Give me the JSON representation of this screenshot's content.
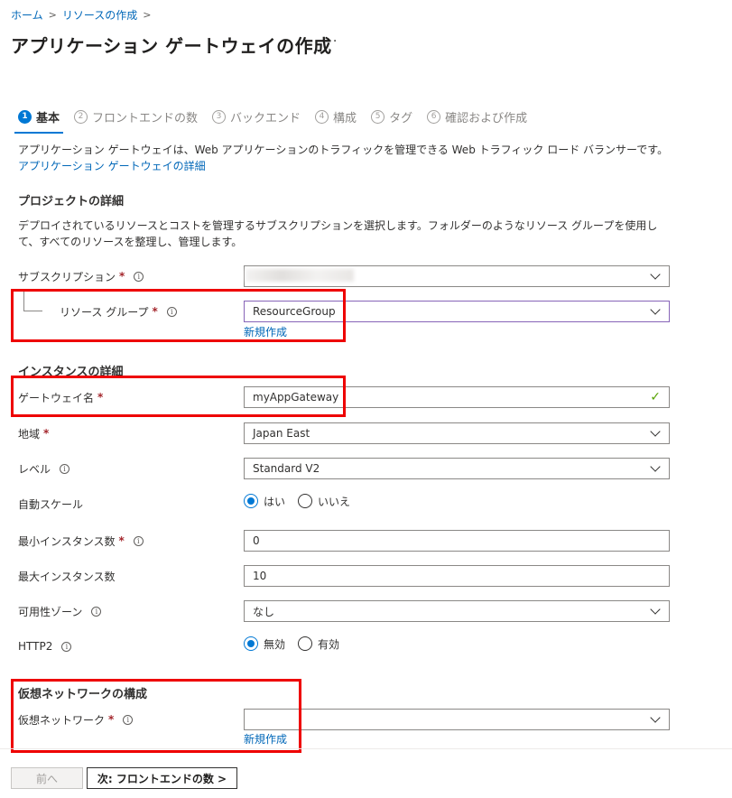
{
  "breadcrumb": {
    "home": "ホーム",
    "create": "リソースの作成",
    "sep": ">"
  },
  "page_title": "アプリケーション ゲートウェイの作成",
  "more_label": "···",
  "steps": [
    {
      "num": "1",
      "label": "基本"
    },
    {
      "num": "2",
      "label": "フロントエンドの数"
    },
    {
      "num": "3",
      "label": "バックエンド"
    },
    {
      "num": "4",
      "label": "構成"
    },
    {
      "num": "5",
      "label": "タグ"
    },
    {
      "num": "6",
      "label": "確認および作成"
    }
  ],
  "intro": {
    "text": "アプリケーション ゲートウェイは、Web アプリケーションのトラフィックを管理できる Web トラフィック ロード バランサーです。",
    "link": "アプリケーション ゲートウェイの詳細"
  },
  "project": {
    "heading": "プロジェクトの詳細",
    "description": "デプロイされているリソースとコストを管理するサブスクリプションを選択します。フォルダーのようなリソース グループを使用して、すべてのリソースを整理し、管理します。",
    "subscription_label": "サブスクリプション",
    "resource_group_label": "リソース グループ",
    "resource_group_value": "ResourceGroup",
    "create_new": "新規作成"
  },
  "instance": {
    "heading": "インスタンスの詳細",
    "gateway_name_label": "ゲートウェイ名",
    "gateway_name_value": "myAppGateway",
    "region_label": "地域",
    "region_value": "Japan East",
    "tier_label": "レベル",
    "tier_value": "Standard V2",
    "autoscale_label": "自動スケール",
    "autoscale_yes": "はい",
    "autoscale_no": "いいえ",
    "min_label": "最小インスタンス数",
    "min_value": "0",
    "max_label": "最大インスタンス数",
    "max_value": "10",
    "zone_label": "可用性ゾーン",
    "zone_value": "なし",
    "http2_label": "HTTP2",
    "http2_disabled": "無効",
    "http2_enabled": "有効"
  },
  "vnet": {
    "heading": "仮想ネットワークの構成",
    "vnet_label": "仮想ネットワーク",
    "vnet_value": "",
    "create_new": "新規作成"
  },
  "required_mark": "*",
  "info_glyph": "i",
  "footer": {
    "prev": "前へ",
    "next": "次: フロントエンドの数 >"
  },
  "colors": {
    "accent": "#0078d4",
    "highlight": "#ee0000",
    "required": "#a4262c",
    "valid": "#57a300"
  }
}
